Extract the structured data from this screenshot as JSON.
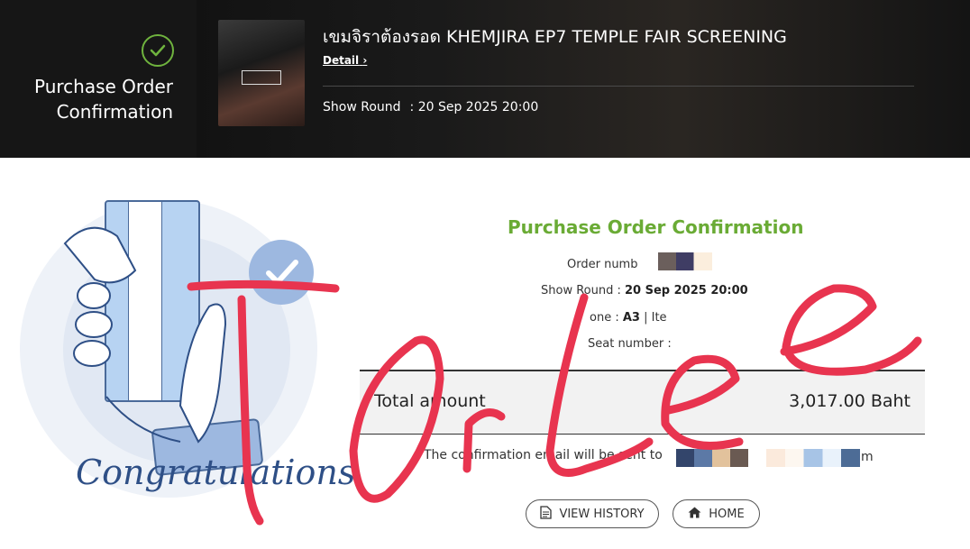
{
  "header": {
    "left_title": "Purchase Order Confirmation",
    "event_title": "เขมจิราต้องรอด KHEMJIRA EP7 TEMPLE FAIR SCREENING",
    "detail_link": "Detail",
    "show_round_label": "Show Round",
    "show_round_value": ": 20 Sep 2025 20:00"
  },
  "illustration": {
    "caption": "Congratulations"
  },
  "confirmation": {
    "title": "Purchase Order Confirmation",
    "order_number_label": "Order numb",
    "show_round_label": "Show Round :",
    "show_round_value": "20 Sep 2025 20:00",
    "zone_label": "one :",
    "zone_value": "A3",
    "zone_extra": "| Ite",
    "seat_label": "Seat number :",
    "total_label": "Total amount",
    "total_value": "3,017.00 Baht",
    "email_text": "The confirmation email will be sent to",
    "email_tail": "m"
  },
  "buttons": {
    "view_history": "VIEW HISTORY",
    "home": "HOME"
  },
  "overlay": {
    "handwriting": "TOrLee"
  },
  "colors": {
    "accent_green": "#6aab35",
    "ink_red": "#e8344f",
    "illustration_blue": "#2e4f86"
  }
}
